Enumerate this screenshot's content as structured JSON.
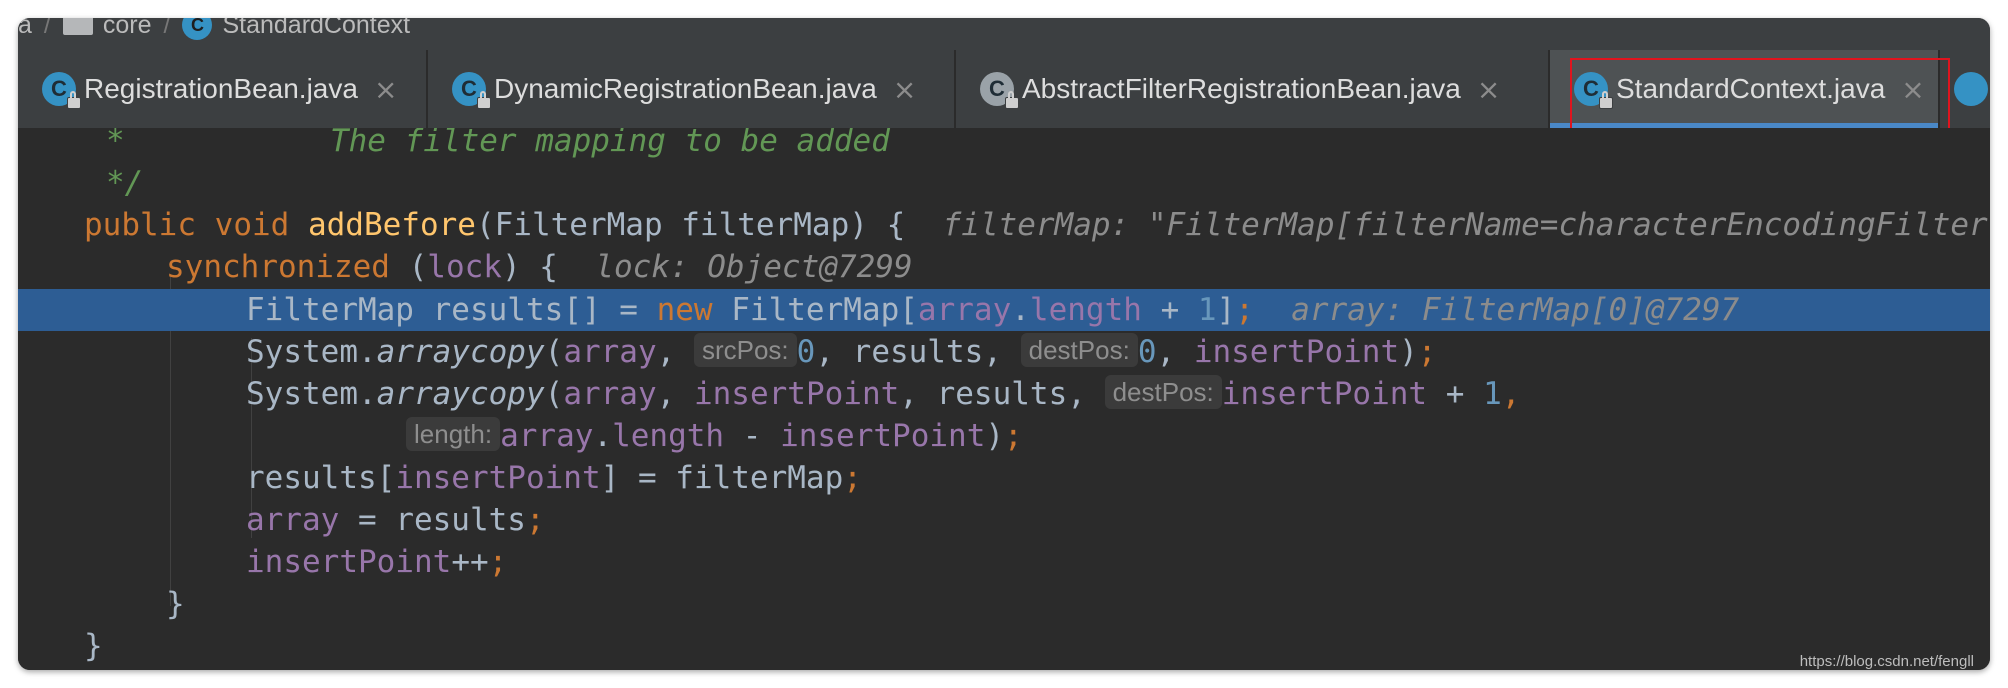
{
  "breadcrumb": {
    "items": [
      "a",
      "core",
      "StandardContext"
    ],
    "separator": "/"
  },
  "tabs": [
    {
      "label": "RegistrationBean.java",
      "icon": "class-icon",
      "close": "×"
    },
    {
      "label": "DynamicRegistrationBean.java",
      "icon": "class-icon",
      "close": "×"
    },
    {
      "label": "AbstractFilterRegistrationBean.java",
      "icon": "abstract-class-icon",
      "close": "×"
    },
    {
      "label": "StandardContext.java",
      "icon": "class-icon",
      "close": "×",
      "active": true
    }
  ],
  "colors": {
    "background": "#2b2b2b",
    "keyword": "#cc7832",
    "method": "#ffc66d",
    "field": "#9876aa",
    "number": "#6897bb",
    "comment": "#629755",
    "highlight": "#2d5d94",
    "tab_outline": "#e0141e"
  },
  "code": {
    "l1_comment": "*           The filter mapping to be added",
    "l2_comment": "*/",
    "l3": {
      "public": "public",
      "void": "void",
      "method": "addBefore",
      "params": "(FilterMap filterMap) {",
      "inlay": "filterMap: \"FilterMap[filterName=characterEncodingFilter"
    },
    "l4": {
      "kw": "synchronized",
      "rest": " (",
      "field": "lock",
      "close": ") {",
      "inlay": "lock: Object@7299"
    },
    "l5": {
      "type": "FilterMap results[] = ",
      "new": "new",
      "ctor": " FilterMap[",
      "f1": "array",
      "dot": ".",
      "f2": "length",
      "plus": " + ",
      "num": "1",
      "close": "]",
      "semi": ";",
      "inlay": "array: FilterMap[0]@7297"
    },
    "l6": {
      "cls": "System.",
      "method": "arraycopy",
      "open": "(",
      "f1": "array",
      "comma1": ", ",
      "hint1": "srcPos:",
      "n1": "0",
      "mid": ", results, ",
      "hint2": "destPos:",
      "n2": "0",
      "comma2": ", ",
      "f2": "insertPoint",
      "close": ")",
      "semi": ";"
    },
    "l7": {
      "cls": "System.",
      "method": "arraycopy",
      "open": "(",
      "f1": "array",
      "comma1": ", ",
      "f2": "insertPoint",
      "mid": ", results, ",
      "hint": "destPos:",
      "f3": "insertPoint",
      "plus": " + ",
      "n": "1",
      "comma2": ","
    },
    "l8": {
      "hint": "length:",
      "f1": "array",
      "dot": ".",
      "f2": "length",
      "minus": " - ",
      "f3": "insertPoint",
      "close": ")",
      "semi": ";"
    },
    "l9": {
      "a": "results[",
      "f": "insertPoint",
      "b": "] = filterMap",
      "semi": ";"
    },
    "l10": {
      "f": "array",
      "b": " = results",
      "semi": ";"
    },
    "l11": {
      "f": "insertPoint",
      "b": "++",
      "semi": ";"
    },
    "l12": "}",
    "l13": "}"
  },
  "watermark": "https://blog.csdn.net/fengll"
}
